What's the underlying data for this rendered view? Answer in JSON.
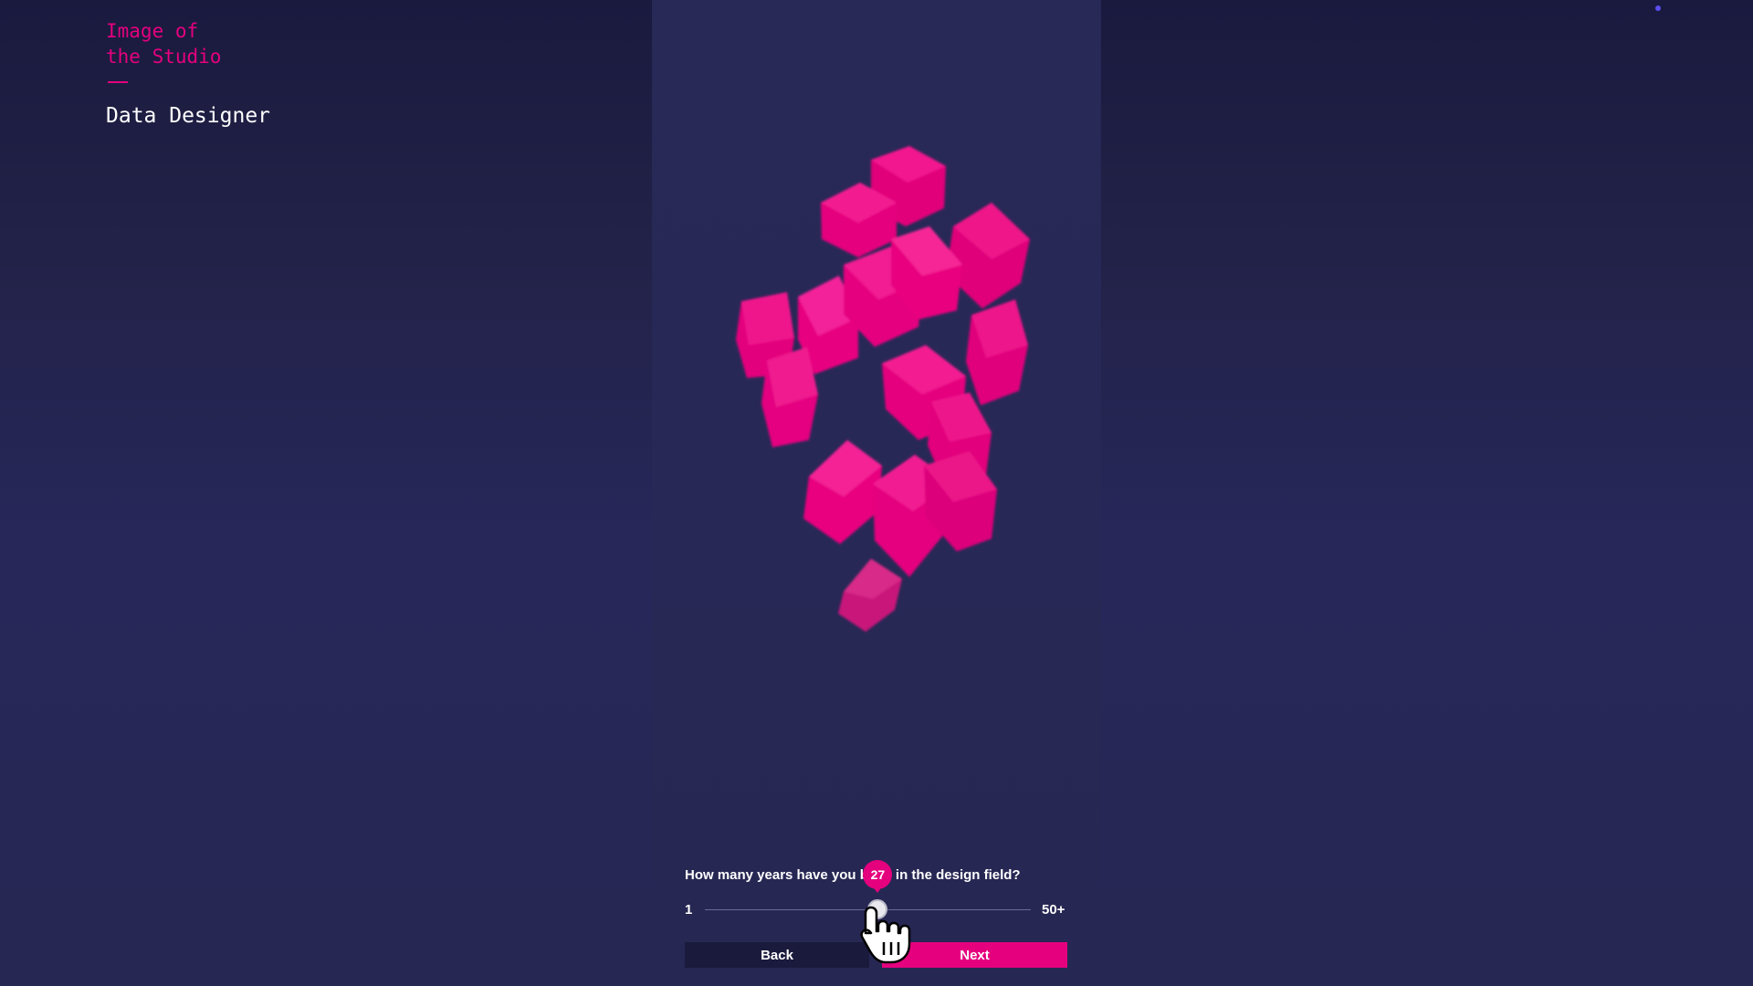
{
  "brand": {
    "title": "Image of\nthe Studio",
    "accent_color": "#e5007e"
  },
  "page": {
    "title": "Data Designer"
  },
  "question": {
    "text": "How many years have you been in the design field?"
  },
  "slider": {
    "min_label": "1",
    "max_label": "50+",
    "min": 1,
    "max": 50,
    "value": 27,
    "value_label": "27"
  },
  "buttons": {
    "back_label": "Back",
    "next_label": "Next"
  },
  "colors": {
    "background": "#26264f",
    "panel": "#292958",
    "accent": "#e5007e",
    "dark_button": "#1a1a3d"
  },
  "icons": {
    "cursor": "hand-pointer-icon",
    "corner_dot": "indicator-dot-icon"
  }
}
